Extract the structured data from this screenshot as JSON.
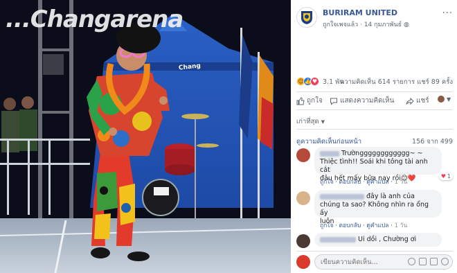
{
  "photo": {
    "banner_text": "...Changarena",
    "tent_text": "Chang"
  },
  "post": {
    "page_name": "BURIRAM UNITED",
    "liked_status": "ถูกใจเพจแล้ว",
    "date": "14 กุมภาพันธ์",
    "more": "···"
  },
  "stats": {
    "reactions_count": "3.1 พัน",
    "comments": "ความคิดเห็น 614 รายการ",
    "shares": "แชร์ 89 ครั้ง"
  },
  "actions": {
    "like": "ถูกใจ",
    "comment": "แสดงความคิดเห็น",
    "share": "แชร์"
  },
  "sort_label": "เก่าที่สุด",
  "comments_header": {
    "previous": "ดูความคิดเห็นก่อนหน้า",
    "count": "156 จาก 499"
  },
  "comments": [
    {
      "text_line1": "Trường",
      "text_line1_rest": "ggggggggggg~ ~",
      "text_line2": "Thiệc tình!! Soái khi tông tài anh cắt",
      "text_line3": "đâu hết mấy bữa nay rồi😊❤️",
      "reply": "ถูกใจ · ตอบกลับ · ดูคำแปล ·",
      "time": "1 วัน",
      "likes": "1"
    },
    {
      "text_line1": "đây là anh của",
      "text_line2": "chúng ta sao? Không nhìn ra ổng ấy",
      "text_line3": "luôn",
      "reply": "ถูกใจ · ตอบกลับ · ดูคำแปล ·",
      "time": "1 วัน"
    },
    {
      "text_line1": "Ui dồi , Chường ơi"
    }
  ],
  "compose": {
    "placeholder": "เขียนความคิดเห็น..."
  },
  "colors": {
    "link": "#385898",
    "meta": "#606770",
    "bubble": "#f2f3f5"
  }
}
